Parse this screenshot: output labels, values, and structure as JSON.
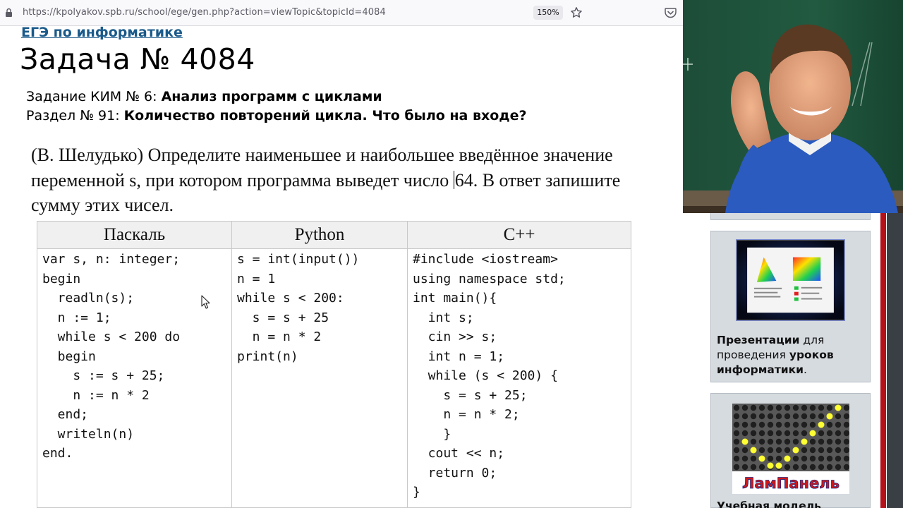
{
  "browser": {
    "url": "https://kpolyakov.spb.ru/school/ege/gen.php?action=viewTopic&topicId=4084",
    "zoom": "150%"
  },
  "page": {
    "breadcrumb": "ЕГЭ по информатике",
    "title": "Задача № 4084",
    "kim_prefix": "Задание КИМ № 6: ",
    "kim_topic": "Анализ программ с циклами",
    "section_prefix": "Раздел № 91: ",
    "section_topic": "Количество повторений цикла. Что было на входе?",
    "problem_before": "(В. Шелудько) Определите наименьшее и наибольшее введённое значение переменной s, при котором программа выведет число ",
    "problem_after": "64. В ответ запишите сумму этих чисел."
  },
  "code_table": {
    "headers": [
      "Паскаль",
      "Python",
      "C++"
    ],
    "pascal": "var s, n: integer;\nbegin\n  readln(s);\n  n := 1;\n  while s < 200 do\n  begin\n    s := s + 25;\n    n := n * 2\n  end;\n  writeln(n)\nend.",
    "python": "s = int(input())\nn = 1\nwhile s < 200:\n  s = s + 25\n  n = n * 2\nprint(n)",
    "cpp": "#include <iostream>\nusing namespace std;\nint main(){\n  int s;\n  cin >> s;\n  int n = 1;\n  while (s < 200) {\n    s = s + 25;\n    n = n * 2;\n    }\n  cout << n;\n  return 0;\n}"
  },
  "sidebar": {
    "ad1_b1": "Презентации",
    "ad1_t1": " для проведения ",
    "ad1_b2": "уроков информатики",
    "ad1_t2": ".",
    "ad2_logo": "ЛамПанель",
    "ad2_caption": "Учебная модель"
  },
  "colors": {
    "link": "#1a5a8a",
    "header_bg": "#f0f0f0",
    "sidebar_bg": "#d6dbe0",
    "accent_red": "#b3121b"
  }
}
